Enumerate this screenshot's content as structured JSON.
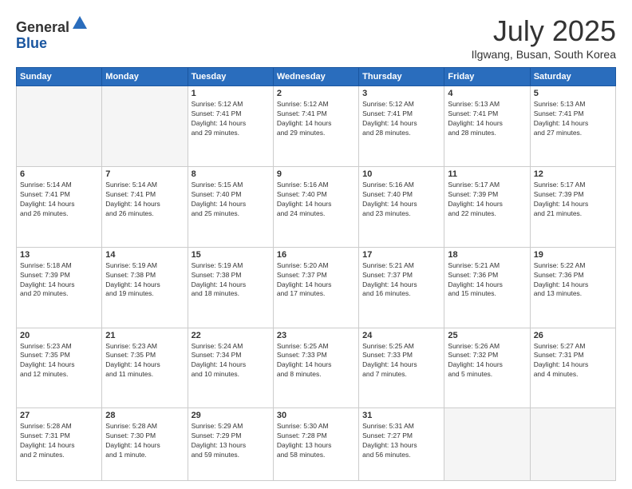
{
  "logo": {
    "general": "General",
    "blue": "Blue"
  },
  "header": {
    "month": "July 2025",
    "location": "Ilgwang, Busan, South Korea"
  },
  "weekdays": [
    "Sunday",
    "Monday",
    "Tuesday",
    "Wednesday",
    "Thursday",
    "Friday",
    "Saturday"
  ],
  "weeks": [
    [
      {
        "day": "",
        "info": ""
      },
      {
        "day": "",
        "info": ""
      },
      {
        "day": "1",
        "info": "Sunrise: 5:12 AM\nSunset: 7:41 PM\nDaylight: 14 hours\nand 29 minutes."
      },
      {
        "day": "2",
        "info": "Sunrise: 5:12 AM\nSunset: 7:41 PM\nDaylight: 14 hours\nand 29 minutes."
      },
      {
        "day": "3",
        "info": "Sunrise: 5:12 AM\nSunset: 7:41 PM\nDaylight: 14 hours\nand 28 minutes."
      },
      {
        "day": "4",
        "info": "Sunrise: 5:13 AM\nSunset: 7:41 PM\nDaylight: 14 hours\nand 28 minutes."
      },
      {
        "day": "5",
        "info": "Sunrise: 5:13 AM\nSunset: 7:41 PM\nDaylight: 14 hours\nand 27 minutes."
      }
    ],
    [
      {
        "day": "6",
        "info": "Sunrise: 5:14 AM\nSunset: 7:41 PM\nDaylight: 14 hours\nand 26 minutes."
      },
      {
        "day": "7",
        "info": "Sunrise: 5:14 AM\nSunset: 7:41 PM\nDaylight: 14 hours\nand 26 minutes."
      },
      {
        "day": "8",
        "info": "Sunrise: 5:15 AM\nSunset: 7:40 PM\nDaylight: 14 hours\nand 25 minutes."
      },
      {
        "day": "9",
        "info": "Sunrise: 5:16 AM\nSunset: 7:40 PM\nDaylight: 14 hours\nand 24 minutes."
      },
      {
        "day": "10",
        "info": "Sunrise: 5:16 AM\nSunset: 7:40 PM\nDaylight: 14 hours\nand 23 minutes."
      },
      {
        "day": "11",
        "info": "Sunrise: 5:17 AM\nSunset: 7:39 PM\nDaylight: 14 hours\nand 22 minutes."
      },
      {
        "day": "12",
        "info": "Sunrise: 5:17 AM\nSunset: 7:39 PM\nDaylight: 14 hours\nand 21 minutes."
      }
    ],
    [
      {
        "day": "13",
        "info": "Sunrise: 5:18 AM\nSunset: 7:39 PM\nDaylight: 14 hours\nand 20 minutes."
      },
      {
        "day": "14",
        "info": "Sunrise: 5:19 AM\nSunset: 7:38 PM\nDaylight: 14 hours\nand 19 minutes."
      },
      {
        "day": "15",
        "info": "Sunrise: 5:19 AM\nSunset: 7:38 PM\nDaylight: 14 hours\nand 18 minutes."
      },
      {
        "day": "16",
        "info": "Sunrise: 5:20 AM\nSunset: 7:37 PM\nDaylight: 14 hours\nand 17 minutes."
      },
      {
        "day": "17",
        "info": "Sunrise: 5:21 AM\nSunset: 7:37 PM\nDaylight: 14 hours\nand 16 minutes."
      },
      {
        "day": "18",
        "info": "Sunrise: 5:21 AM\nSunset: 7:36 PM\nDaylight: 14 hours\nand 15 minutes."
      },
      {
        "day": "19",
        "info": "Sunrise: 5:22 AM\nSunset: 7:36 PM\nDaylight: 14 hours\nand 13 minutes."
      }
    ],
    [
      {
        "day": "20",
        "info": "Sunrise: 5:23 AM\nSunset: 7:35 PM\nDaylight: 14 hours\nand 12 minutes."
      },
      {
        "day": "21",
        "info": "Sunrise: 5:23 AM\nSunset: 7:35 PM\nDaylight: 14 hours\nand 11 minutes."
      },
      {
        "day": "22",
        "info": "Sunrise: 5:24 AM\nSunset: 7:34 PM\nDaylight: 14 hours\nand 10 minutes."
      },
      {
        "day": "23",
        "info": "Sunrise: 5:25 AM\nSunset: 7:33 PM\nDaylight: 14 hours\nand 8 minutes."
      },
      {
        "day": "24",
        "info": "Sunrise: 5:25 AM\nSunset: 7:33 PM\nDaylight: 14 hours\nand 7 minutes."
      },
      {
        "day": "25",
        "info": "Sunrise: 5:26 AM\nSunset: 7:32 PM\nDaylight: 14 hours\nand 5 minutes."
      },
      {
        "day": "26",
        "info": "Sunrise: 5:27 AM\nSunset: 7:31 PM\nDaylight: 14 hours\nand 4 minutes."
      }
    ],
    [
      {
        "day": "27",
        "info": "Sunrise: 5:28 AM\nSunset: 7:31 PM\nDaylight: 14 hours\nand 2 minutes."
      },
      {
        "day": "28",
        "info": "Sunrise: 5:28 AM\nSunset: 7:30 PM\nDaylight: 14 hours\nand 1 minute."
      },
      {
        "day": "29",
        "info": "Sunrise: 5:29 AM\nSunset: 7:29 PM\nDaylight: 13 hours\nand 59 minutes."
      },
      {
        "day": "30",
        "info": "Sunrise: 5:30 AM\nSunset: 7:28 PM\nDaylight: 13 hours\nand 58 minutes."
      },
      {
        "day": "31",
        "info": "Sunrise: 5:31 AM\nSunset: 7:27 PM\nDaylight: 13 hours\nand 56 minutes."
      },
      {
        "day": "",
        "info": ""
      },
      {
        "day": "",
        "info": ""
      }
    ]
  ]
}
